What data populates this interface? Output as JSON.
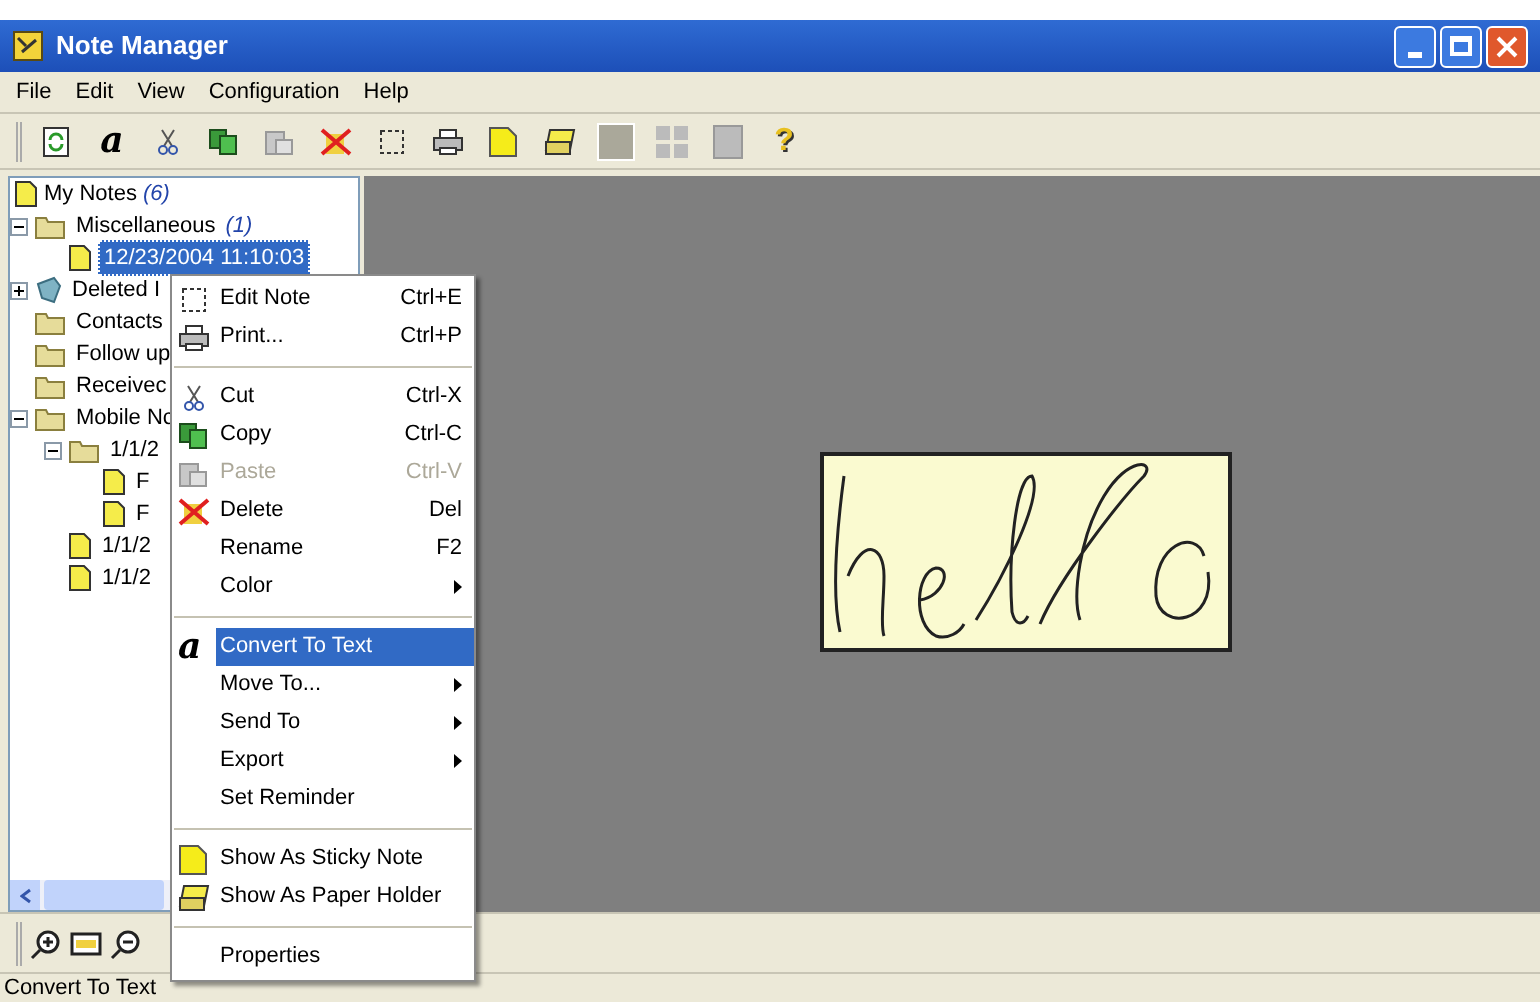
{
  "window": {
    "title": "Note Manager"
  },
  "menu_bar": [
    "File",
    "Edit",
    "View",
    "Configuration",
    "Help"
  ],
  "toolbar": {
    "convert_glyph": "a",
    "help_glyph": "?"
  },
  "tree": {
    "label": "My Notes",
    "count": "(6)",
    "children": [
      {
        "label": "Miscellaneous",
        "count": "(1)",
        "kind": "folder",
        "expanded": true,
        "selected": false,
        "children": [
          {
            "label": "12/23/2004   11:10:03",
            "kind": "note",
            "selected": true
          }
        ]
      },
      {
        "label": "Deleted I",
        "kind": "trash",
        "expanded": false,
        "selected": false
      },
      {
        "label": "Contacts",
        "kind": "folder",
        "selected": false
      },
      {
        "label": "Follow up",
        "kind": "folder",
        "selected": false
      },
      {
        "label": "Receivec",
        "kind": "folder",
        "selected": false
      },
      {
        "label": "Mobile Nc",
        "kind": "folder",
        "expanded": true,
        "selected": false,
        "children": [
          {
            "label": "1/1/2",
            "kind": "folder",
            "expanded": true,
            "selected": false,
            "children": [
              {
                "label": "F",
                "kind": "note",
                "selected": false
              },
              {
                "label": "F",
                "kind": "note",
                "selected": false
              }
            ]
          },
          {
            "label": "1/1/2",
            "kind": "note",
            "selected": false
          },
          {
            "label": "1/1/2",
            "kind": "note",
            "selected": false
          }
        ]
      }
    ]
  },
  "context_menu": [
    {
      "kind": "item",
      "label": "Edit Note",
      "shortcut": "Ctrl+E",
      "disabled": false,
      "selected": false
    },
    {
      "kind": "item",
      "label": "Print...",
      "shortcut": "Ctrl+P",
      "disabled": false,
      "selected": false
    },
    {
      "kind": "separator"
    },
    {
      "kind": "item",
      "label": "Cut",
      "shortcut": "Ctrl-X",
      "disabled": false,
      "selected": false
    },
    {
      "kind": "item",
      "label": "Copy",
      "shortcut": "Ctrl-C",
      "disabled": false,
      "selected": false
    },
    {
      "kind": "item",
      "label": "Paste",
      "shortcut": "Ctrl-V",
      "disabled": true,
      "selected": false
    },
    {
      "kind": "item",
      "label": "Delete",
      "shortcut": "Del",
      "disabled": false,
      "selected": false
    },
    {
      "kind": "item",
      "label": "Rename",
      "shortcut": "F2",
      "disabled": false,
      "selected": false
    },
    {
      "kind": "submenu",
      "label": "Color",
      "disabled": false,
      "selected": false
    },
    {
      "kind": "separator"
    },
    {
      "kind": "item",
      "label": "Convert To Text",
      "glyph": "a",
      "disabled": false,
      "selected": true
    },
    {
      "kind": "submenu",
      "label": "Move To...",
      "disabled": false,
      "selected": false
    },
    {
      "kind": "submenu",
      "label": "Send To",
      "disabled": false,
      "selected": false
    },
    {
      "kind": "submenu",
      "label": "Export",
      "disabled": false,
      "selected": false
    },
    {
      "kind": "item",
      "label": "Set Reminder",
      "disabled": false,
      "selected": false
    },
    {
      "kind": "separator"
    },
    {
      "kind": "item",
      "label": "Show As Sticky Note",
      "disabled": false,
      "selected": false
    },
    {
      "kind": "item",
      "label": "Show As Paper Holder",
      "disabled": false,
      "selected": false
    },
    {
      "kind": "separator"
    },
    {
      "kind": "item",
      "label": "Properties",
      "disabled": false,
      "selected": false
    }
  ],
  "status_bar": "Convert To Text"
}
